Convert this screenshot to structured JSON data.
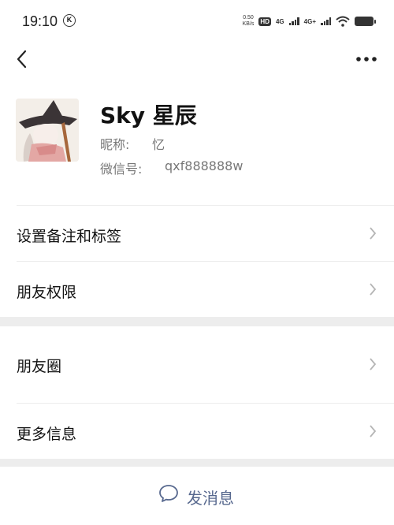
{
  "status_bar": {
    "time": "19:10",
    "k_badge": "K",
    "net_speed_value": "0.50",
    "net_speed_unit": "KB/s",
    "hd_badge": "HD",
    "sim1": "4G",
    "sim2": "4G+",
    "icons": [
      "k-icon",
      "hd-icon",
      "signal-icon",
      "wifi-icon",
      "battery-icon"
    ]
  },
  "nav": {
    "back_icon": "chevron-left-icon",
    "more_icon": "more-dots-icon"
  },
  "profile": {
    "name": "Sky 星辰",
    "nickname_label": "昵称:",
    "nickname_value": "忆",
    "wechat_id_label": "微信号:",
    "wechat_id_value": "qxf888888w"
  },
  "menu": {
    "group1": [
      {
        "label": "设置备注和标签"
      },
      {
        "label": "朋友权限"
      }
    ],
    "group2": [
      {
        "label": "朋友圈"
      },
      {
        "label": "更多信息"
      }
    ]
  },
  "actions": {
    "send_message_label": "发消息",
    "send_message_icon": "chat-bubble-icon"
  },
  "colors": {
    "background": "#ffffff",
    "separator": "#ededed",
    "link_blue": "#57688e",
    "secondary_text": "#777777"
  }
}
